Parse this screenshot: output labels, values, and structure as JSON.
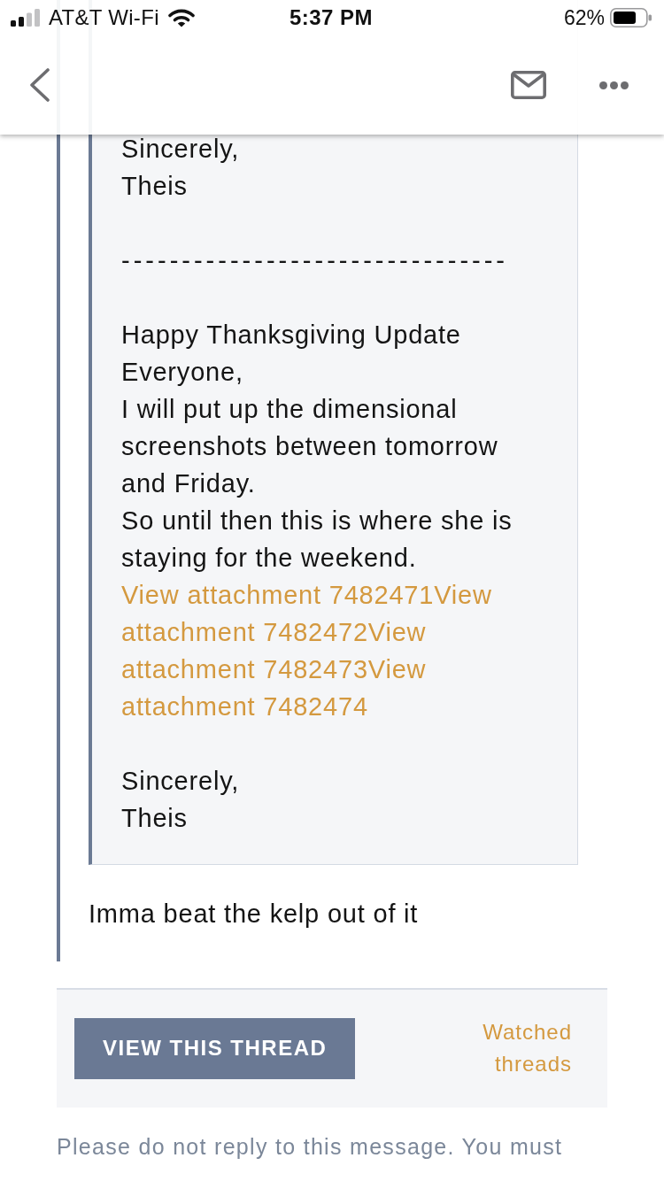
{
  "status_bar": {
    "carrier": "AT&T Wi-Fi",
    "time": "5:37 PM",
    "battery": "62%"
  },
  "post": {
    "quote": {
      "blocks": [
        {
          "items": [
            {
              "kind": "text",
              "text": "Sincerely,"
            },
            {
              "kind": "text",
              "text": "Theis"
            }
          ]
        },
        {
          "items": [
            {
              "kind": "dashes",
              "text": "--------------------------------"
            }
          ]
        },
        {
          "items": [
            {
              "kind": "text",
              "text": "Happy Thanksgiving Update"
            },
            {
              "kind": "text",
              "text": "Everyone,"
            },
            {
              "kind": "text",
              "text": "I will put up the dimensional screenshots between tomorrow and Friday."
            },
            {
              "kind": "text",
              "text": "So until then this is where she is staying for the weekend."
            },
            {
              "kind": "link",
              "text": "View attachment 7482471View attachment 7482472View attachment 7482473View attachment 7482474"
            }
          ]
        },
        {
          "items": [
            {
              "kind": "text",
              "text": "Sincerely,"
            },
            {
              "kind": "text",
              "text": "Theis"
            }
          ]
        }
      ]
    },
    "reply": "Imma beat the kelp out of it"
  },
  "footer": {
    "button": "VIEW THIS THREAD",
    "link": "Watched threads",
    "notice": "Please do not reply to this message. You must"
  }
}
